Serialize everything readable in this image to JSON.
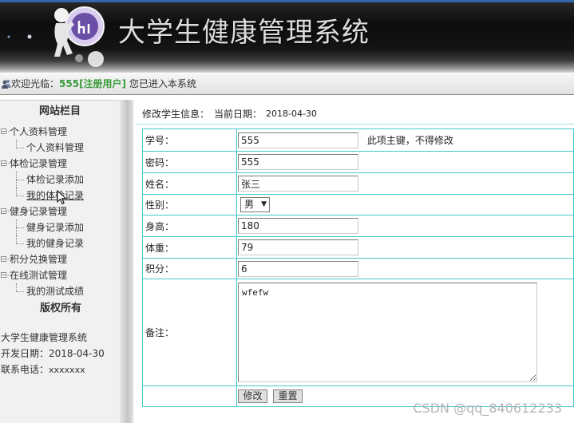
{
  "header": {
    "title": "大学生健康管理系统"
  },
  "welcome": {
    "prefix": "欢迎光临：",
    "user": "555[注册用户]",
    "suffix": "您已进入本系统"
  },
  "sidebar": {
    "title": "网站栏目",
    "groups": [
      {
        "label": "个人资料管理",
        "items": [
          "个人资料管理"
        ]
      },
      {
        "label": "体检记录管理",
        "items": [
          "体检记录添加",
          "我的体检记录"
        ]
      },
      {
        "label": "健身记录管理",
        "items": [
          "健身记录添加",
          "我的健身记录"
        ]
      },
      {
        "label": "积分兑换管理",
        "items": []
      },
      {
        "label": "在线测试管理",
        "items": [
          "我的测试成绩"
        ]
      }
    ],
    "copyright_title": "版权所有",
    "info": [
      "大学生健康管理系统",
      "开发日期：2018-04-30"
    ],
    "phone": {
      "label": "联系电话：",
      "value": "xxxxxxx"
    }
  },
  "main": {
    "heading": "修改学生信息：",
    "date_label": "当前日期：",
    "date_value": "2018-04-30",
    "form": {
      "student_id": {
        "label": "学号：",
        "value": "555",
        "note": "此项主键，不得修改"
      },
      "password": {
        "label": "密码：",
        "value": "555"
      },
      "name": {
        "label": "姓名：",
        "value": "张三"
      },
      "gender": {
        "label": "性别：",
        "value": "男"
      },
      "height": {
        "label": "身高：",
        "value": "180"
      },
      "weight": {
        "label": "体重：",
        "value": "79"
      },
      "points": {
        "label": "积分：",
        "value": "6"
      },
      "remark": {
        "label": "备注：",
        "value": "wfefw"
      },
      "submit_label": "修改",
      "reset_label": "重置"
    }
  },
  "watermark": "CSDN @qq_840612233",
  "colors": {
    "header_top_stripe": "#3467a8",
    "header_bg": "#141414",
    "welcome_user": "#3a9a3a",
    "table_border": "#48c8c8",
    "sidebar_bg": "#f1f1f1"
  },
  "icons": {
    "logo": "mascot-logo",
    "welcome": "user-icon",
    "tree_node": "tree-collapse-icon",
    "select_arrow": "dropdown-arrow-icon",
    "cursor": "mouse-cursor-icon"
  }
}
